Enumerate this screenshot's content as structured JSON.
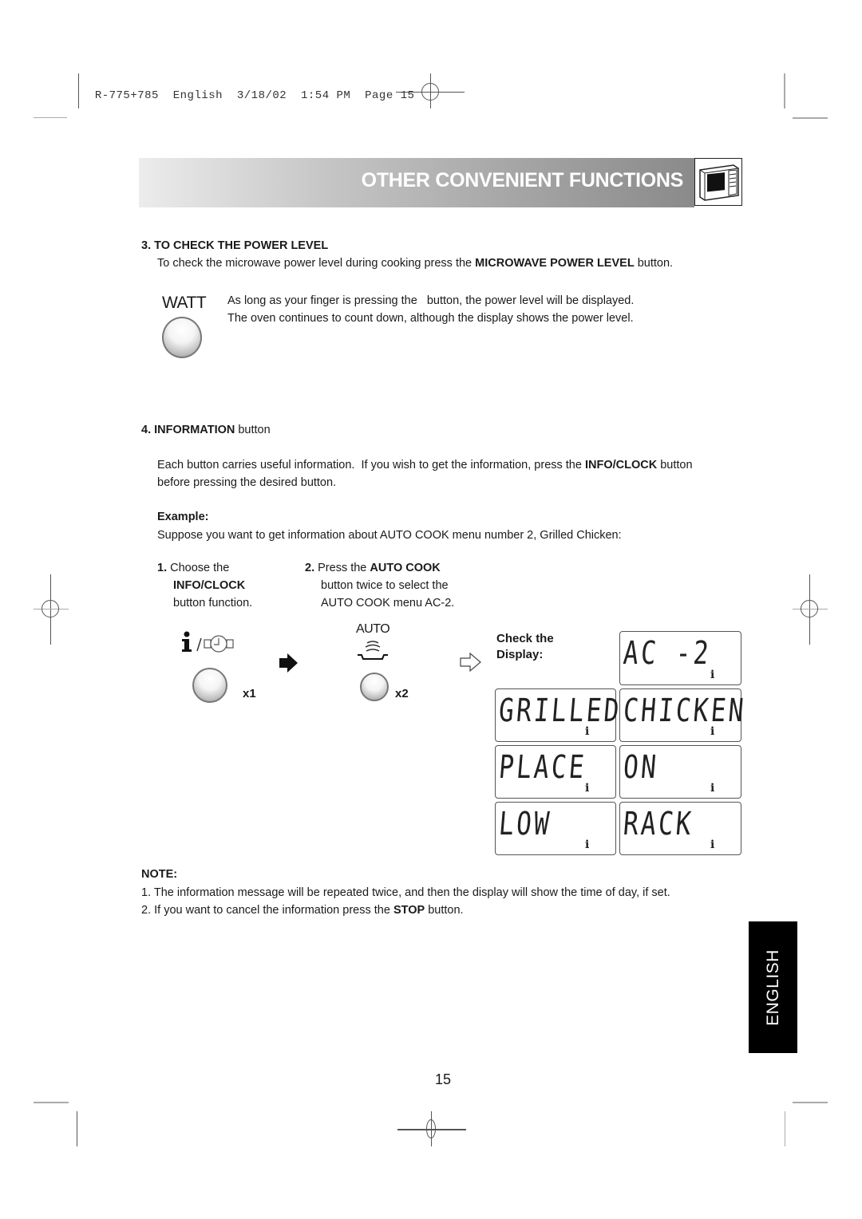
{
  "slug": {
    "model": "R-775+785",
    "language": "English",
    "date": "3/18/02",
    "time": "1:54 PM",
    "page_label": "Page 15"
  },
  "banner": {
    "title": "OTHER CONVENIENT FUNCTIONS",
    "icon": "microwave-oven-icon"
  },
  "section3": {
    "heading": "3. TO CHECK THE POWER LEVEL",
    "intro_pre": "To check the microwave power level during cooking press the ",
    "intro_bold": "MICROWAVE POWER LEVEL",
    "intro_post": " button.",
    "button_label": "WATT",
    "line1": "As long as your finger is pressing the   button, the power level will be displayed.",
    "line2": "The oven continues to count down, although the display shows the power level."
  },
  "section4": {
    "heading_num": "4.",
    "heading_bold": "INFORMATION",
    "heading_post": " button",
    "para_pre": "Each button carries useful information.  If you wish to get the information, press the ",
    "para_bold": "INFO/CLOCK",
    "para_post": " button",
    "para_line2": "before pressing the desired button.",
    "example_label": "Example:",
    "example_text": "Suppose you want to get information about AUTO COOK menu number 2, Grilled Chicken:"
  },
  "steps": [
    {
      "num": "1.",
      "line1": "Choose the",
      "line2_bold": "INFO/CLOCK",
      "line3": "button function.",
      "icon": "info-clock-icon",
      "count": "x1"
    },
    {
      "num": "2.",
      "line1_pre": "Press the ",
      "line1_bold": "AUTO COOK",
      "line2": "button twice to select the",
      "line3": "AUTO COOK menu AC-2.",
      "icon_label": "AUTO",
      "icon": "auto-cook-icon",
      "count": "x2"
    }
  ],
  "check_display": {
    "label_line1": "Check the",
    "label_line2": "Display:",
    "screens": [
      "AC -2",
      "GRILLED",
      "CHICKEN",
      "PLACE",
      "ON",
      "LOW",
      "RACK"
    ],
    "indicator": "i"
  },
  "note": {
    "heading": "NOTE:",
    "item1": "1. The information message will be repeated twice, and then the display will show the time of day, if set.",
    "item2_pre": "2. If you want to cancel the information press the ",
    "item2_bold": "STOP",
    "item2_post": " button."
  },
  "language_tab": "ENGLISH",
  "page_number": "15"
}
